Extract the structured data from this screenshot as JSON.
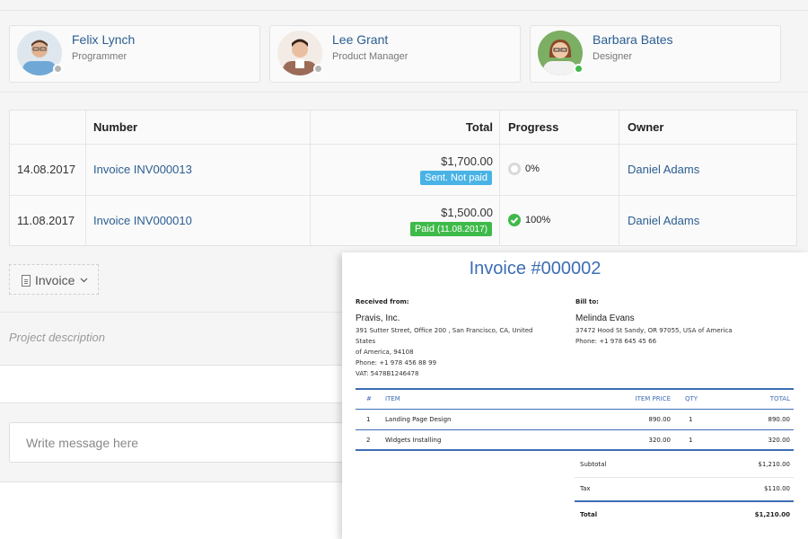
{
  "team": [
    {
      "name": "Felix Lynch",
      "role": "Programmer",
      "status_color": "#b5b5b5"
    },
    {
      "name": "Lee Grant",
      "role": "Product Manager",
      "status_color": "#b5b5b5"
    },
    {
      "name": "Barbara Bates",
      "role": "Designer",
      "status_color": "#3fba4a"
    }
  ],
  "invoices": {
    "headers": {
      "date": "",
      "number": "Number",
      "total": "Total",
      "progress": "Progress",
      "owner": "Owner"
    },
    "rows": [
      {
        "date": "14.08.2017",
        "number": "Invoice INV000013",
        "total": "$1,700.00",
        "status": "Sent. Not paid",
        "status_date": "",
        "progress": "0%",
        "owner": "Daniel Adams"
      },
      {
        "date": "11.08.2017",
        "number": "Invoice INV000010",
        "total": "$1,500.00",
        "status": "Paid",
        "status_date": "(11.08.2017)",
        "progress": "100%",
        "owner": "Daniel Adams"
      }
    ]
  },
  "toolbar": {
    "invoice_label": "Invoice",
    "chevron": "⌄"
  },
  "project": {
    "description_placeholder": "Project description"
  },
  "message": {
    "placeholder": "Write message here"
  },
  "invoice_doc": {
    "title": "Invoice #000002",
    "received_from_label": "Received from:",
    "bill_to_label": "Bill to:",
    "from": {
      "name": "Pravis, Inc.",
      "address_1": "391 Sutter Street, Office 200 , San Francisco, CA, United States",
      "address_2": "of America, 94108",
      "phone": "Phone: +1 978 456 88 99",
      "vat": "VAT: 5478B1246478"
    },
    "to": {
      "name": "Melinda Evans",
      "address": "37472 Hood St Sandy, OR 97055, USA of America",
      "phone": "Phone: +1 978 645 45 66"
    },
    "item_headers": {
      "num": "#",
      "item": "ITEM",
      "price": "ITEM PRICE",
      "qty": "QTY",
      "total": "TOTAL"
    },
    "items": [
      {
        "num": "1",
        "item": "Landing Page Design",
        "price": "890.00",
        "qty": "1",
        "total": "890.00"
      },
      {
        "num": "2",
        "item": "Widgets Installing",
        "price": "320.00",
        "qty": "1",
        "total": "320.00"
      }
    ],
    "subtotal_label": "Subtotal",
    "subtotal": "$1,210.00",
    "tax_label": "Tax",
    "tax": "$110.00",
    "total_label": "Total",
    "total": "$1,210.00"
  },
  "colors": {
    "link": "#2b5d91",
    "accent": "#3d6db5",
    "sent": "#4ab3e6",
    "paid": "#3fba4a"
  }
}
